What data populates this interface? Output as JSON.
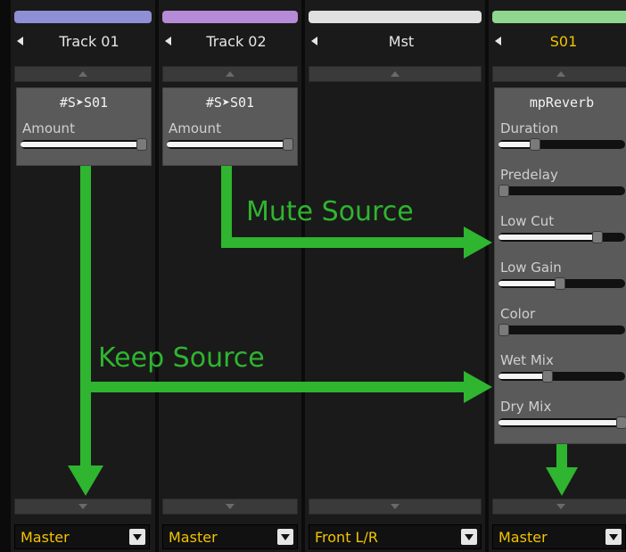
{
  "strips": [
    {
      "name": "Track 01",
      "name_color": "#e6e6e6",
      "color_bar": "#8f8fd6",
      "output": "Master",
      "plugin": {
        "title": "#S➤S01",
        "params": [
          {
            "label": "Amount",
            "value": 0.97
          }
        ]
      }
    },
    {
      "name": "Track 02",
      "name_color": "#e6e6e6",
      "color_bar": "#b58ad6",
      "output": "Master",
      "plugin": {
        "title": "#S➤S01",
        "params": [
          {
            "label": "Amount",
            "value": 0.97
          }
        ]
      }
    },
    {
      "name": "Mst",
      "name_color": "#e6e6e6",
      "color_bar": "#e0e0e0",
      "output": "Front L/R"
    },
    {
      "name": "S01",
      "name_color": "#f2c400",
      "color_bar": "#8fd68f",
      "output": "Master",
      "plugin": {
        "title": "mpReverb",
        "params": [
          {
            "label": "Duration",
            "value": 0.3
          },
          {
            "label": "Predelay",
            "value": 0.0
          },
          {
            "label": "Low Cut",
            "value": 0.77
          },
          {
            "label": "Low Gain",
            "value": 0.47
          },
          {
            "label": "Color",
            "value": 0.0
          },
          {
            "label": "Wet Mix",
            "value": 0.37
          },
          {
            "label": "Dry Mix",
            "value": 0.97
          }
        ]
      }
    }
  ],
  "annotations": {
    "mute_source": "Mute Source",
    "keep_source": "Keep Source",
    "arrow_color": "#2fb52f"
  }
}
